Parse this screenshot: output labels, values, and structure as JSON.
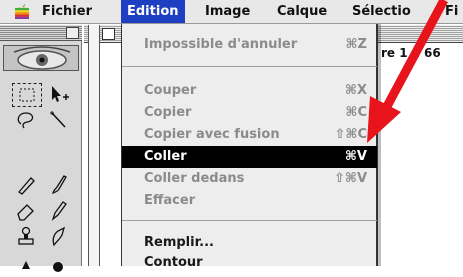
{
  "menubar": {
    "items": [
      {
        "label": "Fichier"
      },
      {
        "label": "Edition"
      },
      {
        "label": "Image"
      },
      {
        "label": "Calque"
      },
      {
        "label": "Sélectio"
      },
      {
        "label": "Fi"
      }
    ]
  },
  "document": {
    "title_fragment": "re 1 à 66"
  },
  "edit_menu": {
    "items": [
      {
        "label": "Impossible d'annuler",
        "shortcut": "⌘Z",
        "enabled": false
      },
      {
        "label": "Couper",
        "shortcut": "⌘X",
        "enabled": false
      },
      {
        "label": "Copier",
        "shortcut": "⌘C",
        "enabled": false
      },
      {
        "label": "Copier avec fusion",
        "shortcut": "⇧⌘C",
        "enabled": false
      },
      {
        "label": "Coller",
        "shortcut": "⌘V",
        "enabled": true,
        "highlighted": true
      },
      {
        "label": "Coller dedans",
        "shortcut": "⇧⌘V",
        "enabled": false
      },
      {
        "label": "Effacer",
        "shortcut": "",
        "enabled": false
      },
      {
        "label": "Remplir...",
        "shortcut": "",
        "enabled": true
      },
      {
        "label": "Contour",
        "shortcut": "",
        "enabled": true
      }
    ]
  },
  "colors": {
    "menubar_active": "#1e3fc2",
    "highlight": "#000000",
    "arrow": "#e8141c"
  }
}
